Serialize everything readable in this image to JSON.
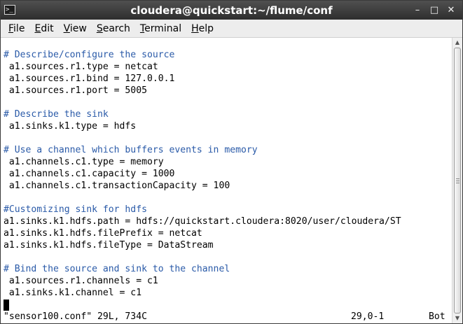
{
  "window": {
    "title": "cloudera@quickstart:~/flume/conf",
    "icon": "terminal-icon",
    "buttons": {
      "minimize": "–",
      "maximize": "□",
      "close": "✕"
    }
  },
  "menu": {
    "file": {
      "mnemonic": "F",
      "rest": "ile"
    },
    "edit": {
      "mnemonic": "E",
      "rest": "dit"
    },
    "view": {
      "mnemonic": "V",
      "rest": "iew"
    },
    "search": {
      "mnemonic": "S",
      "rest": "earch"
    },
    "terminal": {
      "mnemonic": "T",
      "rest": "erminal"
    },
    "help": {
      "mnemonic": "H",
      "rest": "elp"
    }
  },
  "terminal": {
    "lines": [
      "# Describe/configure the source",
      " a1.sources.r1.type = netcat",
      " a1.sources.r1.bind = 127.0.0.1",
      " a1.sources.r1.port = 5005",
      "",
      "# Describe the sink",
      " a1.sinks.k1.type = hdfs",
      "",
      "# Use a channel which buffers events in memory",
      " a1.channels.c1.type = memory",
      " a1.channels.c1.capacity = 1000",
      " a1.channels.c1.transactionCapacity = 100",
      "",
      "#Customizing sink for hdfs",
      "a1.sinks.k1.hdfs.path = hdfs://quickstart.cloudera:8020/user/cloudera/ST",
      "a1.sinks.k1.hdfs.filePrefix = netcat",
      "a1.sinks.k1.hdfs.fileType = DataStream",
      "",
      "# Bind the source and sink to the channel",
      " a1.sources.r1.channels = c1",
      " a1.sinks.k1.channel = c1"
    ],
    "status": {
      "file_info": "\"sensor100.conf\" 29L, 734C",
      "cursor_position": "29,0-1",
      "scroll_position": "Bot"
    }
  },
  "colors": {
    "comment": "#2a5aa8",
    "text": "#000000",
    "background": "#ffffff",
    "titlebar": "#3a3a3a"
  }
}
